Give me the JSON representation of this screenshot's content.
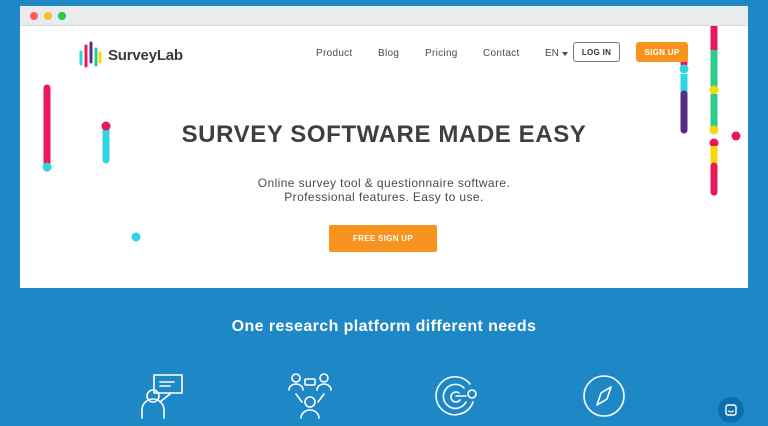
{
  "brand": {
    "name": "SurveyLab",
    "colors": {
      "accent_orange": "#f7931e",
      "background_blue": "#1e88c7",
      "magenta": "#e8185c",
      "cyan": "#2fd6e0",
      "purple": "#5a2c8a",
      "green": "#2ecc8a",
      "yellow": "#f5d90a"
    }
  },
  "nav": {
    "items": [
      "Product",
      "Blog",
      "Pricing",
      "Contact"
    ],
    "language": "EN",
    "login_label": "LOG IN",
    "signup_label": "SIGN UP"
  },
  "hero": {
    "title": "SURVEY SOFTWARE MADE EASY",
    "subtitle_line1": "Online survey tool & questionnaire software.",
    "subtitle_line2": "Professional features. Easy to use.",
    "cta_label": "FREE SIGN UP"
  },
  "section": {
    "title": "One research platform different needs",
    "feature_icons": [
      "presentation-icon",
      "team-icon",
      "target-chart-icon",
      "compass-icon"
    ]
  },
  "chat": {
    "icon": "chat-icon"
  }
}
